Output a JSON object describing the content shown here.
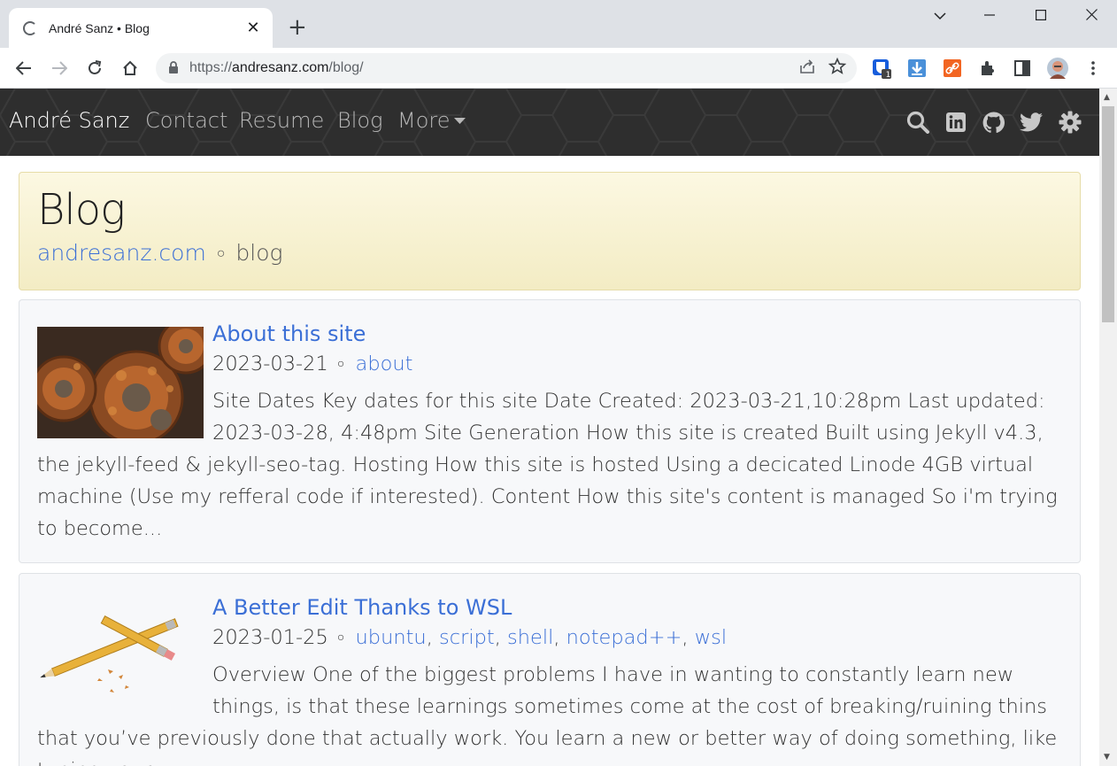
{
  "browser": {
    "tab_title": "André Sanz • Blog",
    "url_host": "andresanz.com",
    "url_scheme": "https://",
    "url_path": "/blog/",
    "extension_badge": "1"
  },
  "site": {
    "brand": "André Sanz",
    "nav": [
      "Contact",
      "Resume",
      "Blog",
      "More"
    ],
    "icons": [
      "search-icon",
      "linkedin-icon",
      "github-icon",
      "twitter-icon",
      "gear-icon"
    ]
  },
  "header": {
    "title": "Blog",
    "breadcrumb_home": "andresanz.com",
    "breadcrumb_sep": "○",
    "breadcrumb_current": "blog"
  },
  "posts": [
    {
      "title": "About this site",
      "date": "2023-03-21",
      "sep": "○",
      "tags": [
        "about"
      ],
      "excerpt": "Site Dates Key dates for this site Date Created: 2023-03-21,10:28pm Last updated: 2023-03-28, 4:48pm Site Generation How this site is created Built using Jekyll v4.3, the jekyll-feed & jekyll-seo-tag. Hosting How this site is hosted Using a decicated Linode 4GB virtual machine (Use my refferal code if interested). Content How this site's content is managed So i'm trying to become..."
    },
    {
      "title": "A Better Edit Thanks to WSL",
      "date": "2023-01-25",
      "sep": "○",
      "tags": [
        "ubuntu",
        "script",
        "shell",
        "notepad++",
        "wsl"
      ],
      "excerpt": "Overview One of the biggest problems I have in wanting to constantly learn new things, is that these learnings sometimes come at the cost of breaking/ruining thins that you’ve previously done that actually work. You learn a new or better way of doing something, like tuning your"
    }
  ],
  "colors": {
    "nav_bg": "#2e2e2e",
    "link": "#3b6fd6",
    "header_bg": "#fcf8e2"
  }
}
